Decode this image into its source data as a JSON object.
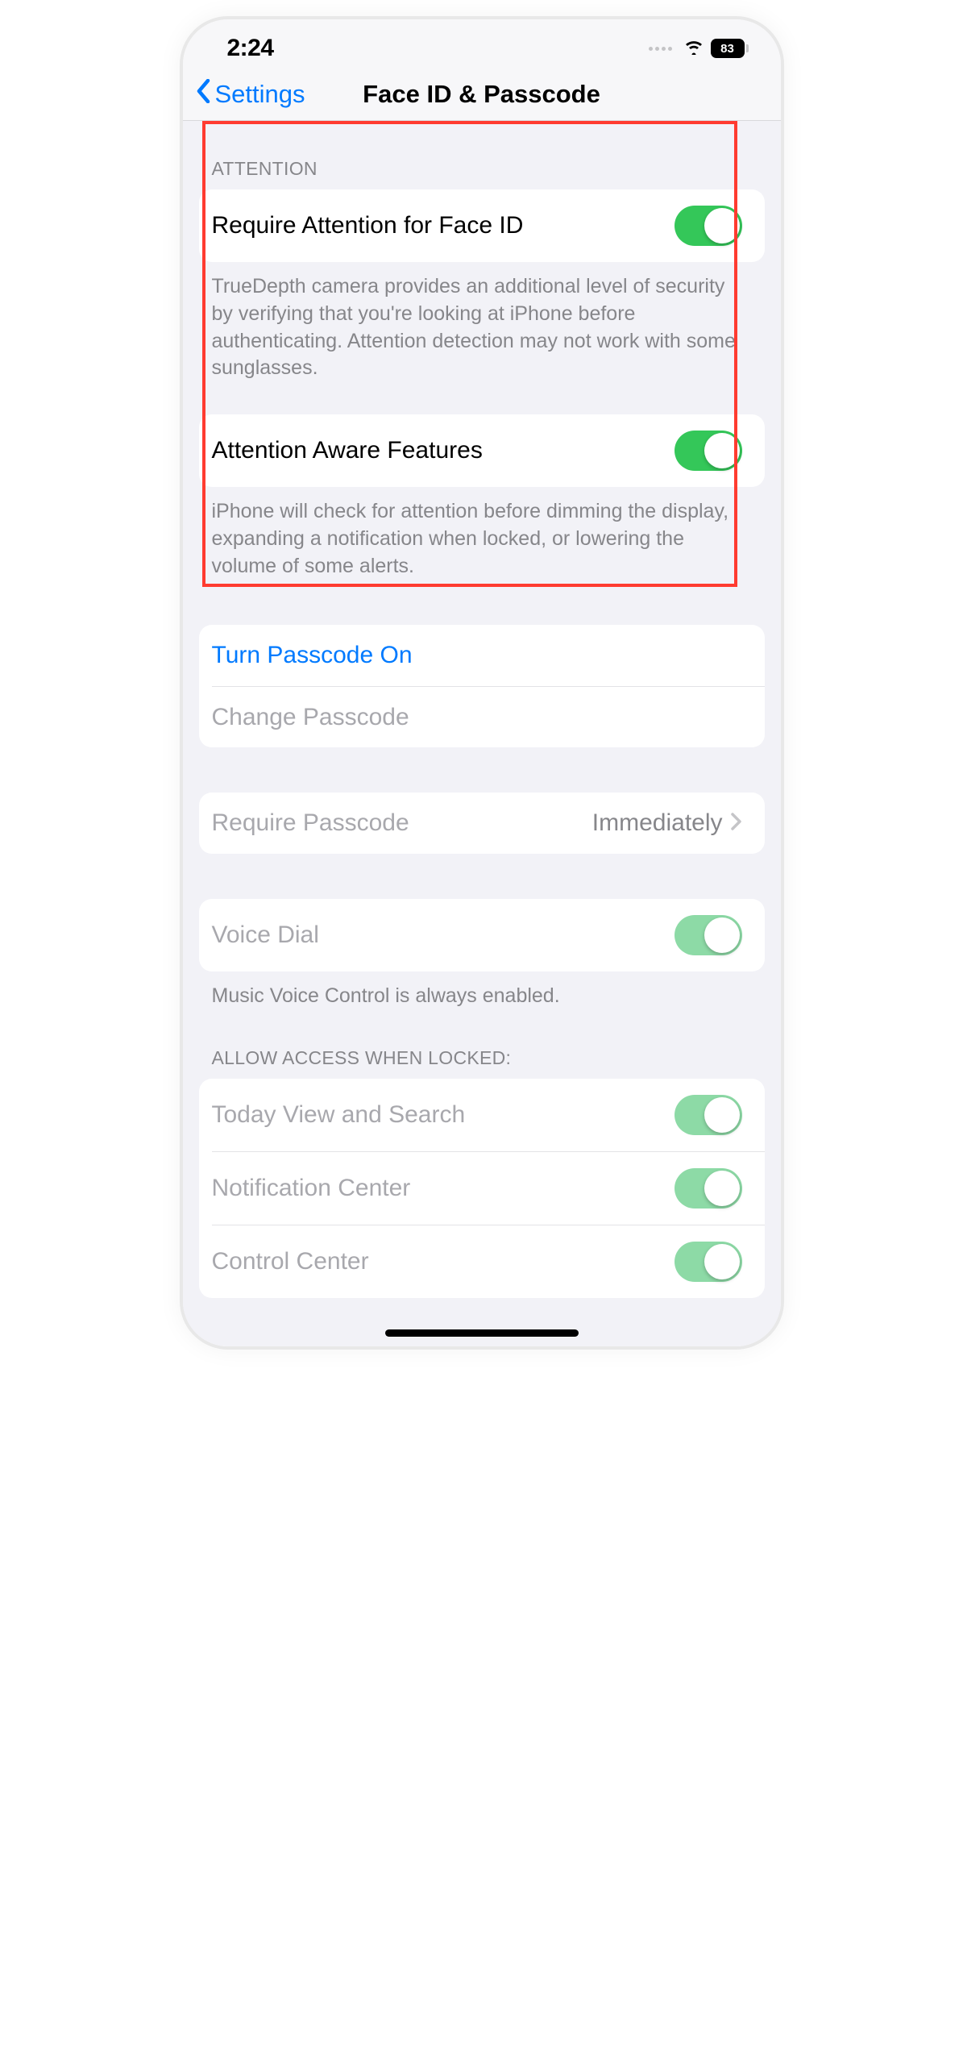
{
  "statusBar": {
    "time": "2:24",
    "battery": "83"
  },
  "nav": {
    "back": "Settings",
    "title": "Face ID & Passcode"
  },
  "sections": {
    "attention": {
      "header": "ATTENTION",
      "requireAttention": {
        "label": "Require Attention for Face ID",
        "footer": "TrueDepth camera provides an additional level of security by verifying that you're looking at iPhone before authenticating. Attention detection may not work with some sunglasses."
      },
      "attentionAware": {
        "label": "Attention Aware Features",
        "footer": "iPhone will check for attention before dimming the display, expanding a notification when locked, or lowering the volume of some alerts."
      }
    },
    "passcode": {
      "turnOn": "Turn Passcode On",
      "change": "Change Passcode"
    },
    "requirePasscode": {
      "label": "Require Passcode",
      "value": "Immediately"
    },
    "voiceDial": {
      "label": "Voice Dial",
      "footer": "Music Voice Control is always enabled."
    },
    "allowAccess": {
      "header": "ALLOW ACCESS WHEN LOCKED:",
      "todayView": "Today View and Search",
      "notificationCenter": "Notification Center",
      "controlCenter": "Control Center"
    }
  }
}
